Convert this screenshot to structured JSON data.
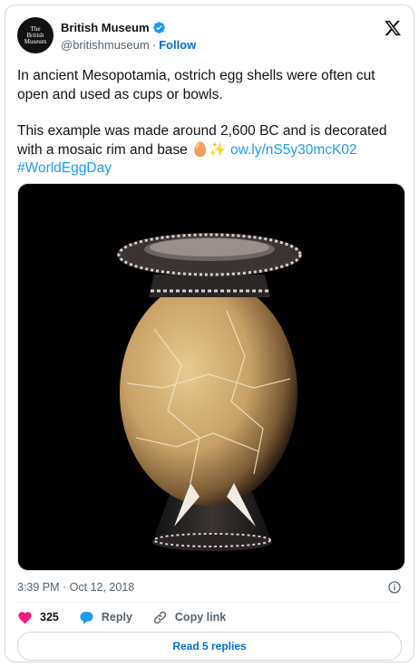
{
  "account": {
    "avatar_text": [
      "The",
      "British",
      "Museum"
    ],
    "name": "British Museum",
    "handle": "@britishmuseum",
    "follow_label": "Follow"
  },
  "tweet": {
    "line1": "In ancient Mesopotamia, ostrich egg shells were often cut open and used as cups or bowls.",
    "line2_text": "This example was made around 2,600 BC and is decorated with a mosaic rim and base ",
    "emoji": "🥚✨",
    "link": "ow.ly/nS5y30mcK02",
    "hashtag": "#WorldEggDay"
  },
  "meta": {
    "timestamp": "3:39 PM · Oct 12, 2018"
  },
  "actions": {
    "like_count": "325",
    "reply_label": "Reply",
    "copy_label": "Copy link"
  },
  "replies_button": "Read 5 replies",
  "colors": {
    "accent": "#1d9bf0",
    "like": "#f91880",
    "text": "#0f1419",
    "muted": "#536471"
  }
}
